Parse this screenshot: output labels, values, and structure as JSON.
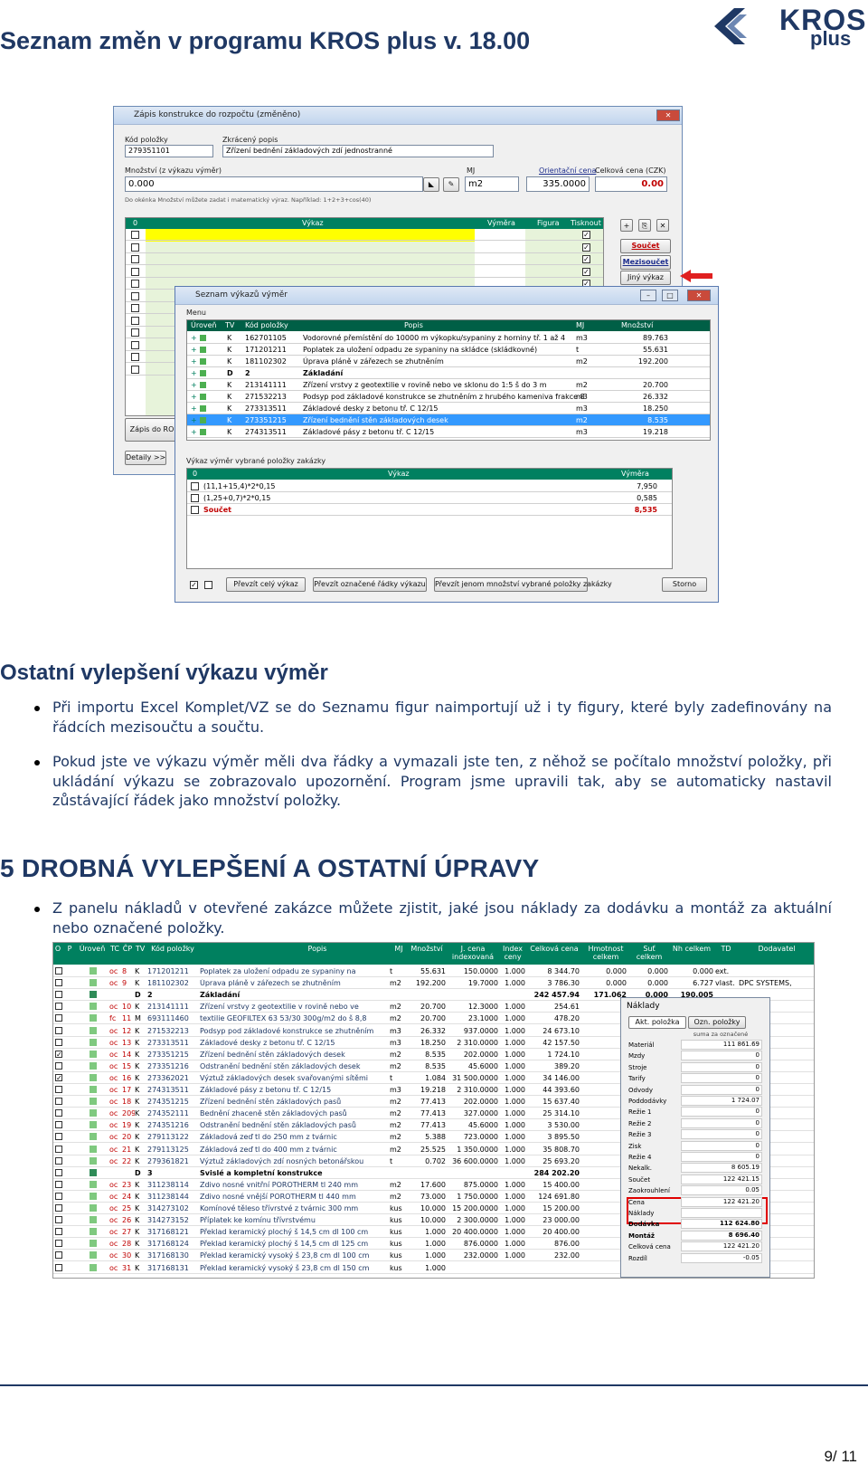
{
  "header": {
    "title": "Seznam změn v programu KROS plus v. 18.00",
    "logo_main": "KROS",
    "logo_sub": "plus"
  },
  "dialog1": {
    "title": "Zápis konstrukce do rozpočtu (změněno)",
    "kod_label": "Kód položky",
    "kod_value": "279351101",
    "popis_label": "Zkrácený popis",
    "popis_value": "Zřízení bednění základových zdí jednostranné",
    "mnozstvi_label": "Množství (z výkazu výměr)",
    "mnozstvi_value": "0.000",
    "hint": "Do okénka Množství můžete zadat i matematický výraz. Například: 1+2+3+cos(40)",
    "mj_label": "MJ",
    "mj_value": "m2",
    "cena_label": "Orientační cena",
    "cena_value": "335.0000",
    "celkova_label": "Celková cena (CZK)",
    "celkova_value": "0.00",
    "grid_headers": [
      "0",
      "Výkaz",
      "Výměra",
      "Figura",
      "Tisknout"
    ],
    "btn_soucet": "Součet",
    "btn_mezisoucet": "Mezisoučet",
    "btn_jiny": "Jiný výkaz",
    "btn_zapis": "Zápis do RO",
    "btn_detaily": "Detaily >>"
  },
  "dialog2": {
    "title": "Seznam výkazů výměr",
    "menu": "Menu",
    "headers": [
      "Úroveň",
      "TV",
      "Kód položky",
      "Popis",
      "MJ",
      "Množství"
    ],
    "rows": [
      {
        "tv": "K",
        "kod": "162701105",
        "popis": "Vodorovné přemístění do 10000 m výkopku/sypaniny z horniny tř. 1 až 4",
        "mj": "m3",
        "mn": "89.763"
      },
      {
        "tv": "K",
        "kod": "171201211",
        "popis": "Poplatek za uložení odpadu ze sypaniny na skládce (skládkovné)",
        "mj": "t",
        "mn": "55.631"
      },
      {
        "tv": "K",
        "kod": "181102302",
        "popis": "Úprava pláně v zářezech se zhutněním",
        "mj": "m2",
        "mn": "192.200"
      },
      {
        "tv": "D",
        "kod": "2",
        "popis": "Základání",
        "mj": "",
        "mn": ""
      },
      {
        "tv": "K",
        "kod": "213141111",
        "popis": "Zřízení vrstvy z geotextilie v rovině nebo ve sklonu do 1:5 š do 3 m",
        "mj": "m2",
        "mn": "20.700"
      },
      {
        "tv": "K",
        "kod": "271532213",
        "popis": "Podsyp pod základové konstrukce se zhutněním z hrubého kameniva frakce 8",
        "mj": "m3",
        "mn": "26.332"
      },
      {
        "tv": "K",
        "kod": "273313511",
        "popis": "Základové desky z betonu tř. C 12/15",
        "mj": "m3",
        "mn": "18.250"
      },
      {
        "tv": "K",
        "kod": "273351215",
        "popis": "Zřízení bednění stěn základových desek",
        "mj": "m2",
        "mn": "8.535"
      },
      {
        "tv": "K",
        "kod": "274313511",
        "popis": "Základové pásy z betonu tř. C 12/15",
        "mj": "m3",
        "mn": "19.218"
      }
    ],
    "sub_title": "Výkaz výměr vybrané položky zakázky",
    "sub_headers": [
      "0",
      "Výkaz",
      "Výměra"
    ],
    "sub_rows": [
      {
        "vykaz": "(11,1+15,4)*2*0,15",
        "vymera": "7,950"
      },
      {
        "vykaz": "(1,25+0,7)*2*0,15",
        "vymera": "0,585"
      },
      {
        "vykaz": "Součet",
        "vymera": "8,535"
      }
    ],
    "btn_cely": "Převzít celý výkaz",
    "btn_oznacene": "Převzít označené řádky výkazu",
    "btn_mnozstvi": "Převzít jenom množství vybrané položky zakázky",
    "btn_storno": "Storno"
  },
  "section1": {
    "title": "Ostatní vylepšení výkazu výměr",
    "bullets": [
      "Při importu Excel Komplet/VZ se do Seznamu figur naimportují už i ty figury, které byly zadefinovány na řádcích mezisoučtu a součtu.",
      "Pokud jste ve výkazu výměr měli dva řádky a vymazali jste ten, z něhož se počítalo množství položky, při ukládání výkazu se zobrazovalo upozornění. Program jsme upravili tak, aby se automaticky nastavil zůstávající řádek jako množství položky."
    ]
  },
  "section2": {
    "title": "5 DROBNÁ VYLEPŠENÍ A OSTATNÍ ÚPRAVY",
    "bullets": [
      "Z panelu nákladů v otevřené zakázce můžete zjistit, jaké jsou náklady za dodávku a montáž za aktuální nebo označené položky."
    ]
  },
  "table2": {
    "headers": [
      "O",
      "P",
      "Úroveň",
      "TC",
      "ČP",
      "TV",
      "Kód položky",
      "Popis",
      "MJ",
      "Množství",
      "J. cena indexovaná",
      "Index ceny",
      "Celková cena",
      "Hmotnost celkem",
      "Suť celkem",
      "Nh celkem",
      "TD",
      "Dodavatel"
    ],
    "rows": [
      {
        "tc": "oc",
        "cp": "8",
        "tv": "K",
        "kod": "171201211",
        "popis": "Poplatek za uložení odpadu ze sypaniny na",
        "mj": "t",
        "mn": "55.631",
        "jc": "150.0000",
        "idx": "1.000",
        "cc": "8 344.70",
        "hm": "0.000",
        "sut": "0.000",
        "nh": "0.000",
        "td": "ext.",
        "dod": "",
        "check": false
      },
      {
        "tc": "oc",
        "cp": "9",
        "tv": "K",
        "kod": "181102302",
        "popis": "Úprava pláně v zářezech se zhutněním",
        "mj": "m2",
        "mn": "192.200",
        "jc": "19.7000",
        "idx": "1.000",
        "cc": "3 786.30",
        "hm": "0.000",
        "sut": "0.000",
        "nh": "6.727",
        "td": "vlast.",
        "dod": "DPC SYSTEMS,",
        "check": false
      },
      {
        "tc": "",
        "cp": "",
        "tv": "D",
        "kod": "2",
        "popis": "Základání",
        "mj": "",
        "mn": "",
        "jc": "",
        "idx": "",
        "cc": "242 457.94",
        "hm": "171.062",
        "sut": "0.000",
        "nh": "190.005",
        "td": "",
        "dod": "",
        "check": false,
        "d": true
      },
      {
        "tc": "oc",
        "cp": "10",
        "tv": "K",
        "kod": "213141111",
        "popis": "Zřízení vrstvy z geotextilie v rovině nebo ve",
        "mj": "m2",
        "mn": "20.700",
        "jc": "12.3000",
        "idx": "1.000",
        "cc": "254.61",
        "hm": "",
        "sut": "",
        "nh": "",
        "td": "",
        "dod": "",
        "check": false
      },
      {
        "tc": "fc",
        "cp": "11",
        "tv": "M",
        "kod": "693111460",
        "popis": "textilie GEOFILTEX 63 53/30 300g/m2 do š 8,8",
        "mj": "m2",
        "mn": "20.700",
        "jc": "23.1000",
        "idx": "1.000",
        "cc": "478.20",
        "hm": "",
        "sut": "",
        "nh": "",
        "td": "",
        "dod": "",
        "check": false
      },
      {
        "tc": "oc",
        "cp": "12",
        "tv": "K",
        "kod": "271532213",
        "popis": "Podsyp pod základové konstrukce se zhutněním",
        "mj": "m3",
        "mn": "26.332",
        "jc": "937.0000",
        "idx": "1.000",
        "cc": "24 673.10",
        "hm": "",
        "sut": "",
        "nh": "",
        "td": "",
        "dod": "",
        "check": false
      },
      {
        "tc": "oc",
        "cp": "13",
        "tv": "K",
        "kod": "273313511",
        "popis": "Základové desky z betonu tř. C 12/15",
        "mj": "m3",
        "mn": "18.250",
        "jc": "2 310.0000",
        "idx": "1.000",
        "cc": "42 157.50",
        "hm": "",
        "sut": "",
        "nh": "",
        "td": "",
        "dod": "",
        "check": false
      },
      {
        "tc": "oc",
        "cp": "14",
        "tv": "K",
        "kod": "273351215",
        "popis": "Zřízení bednění stěn základových desek",
        "mj": "m2",
        "mn": "8.535",
        "jc": "202.0000",
        "idx": "1.000",
        "cc": "1 724.10",
        "hm": "",
        "sut": "",
        "nh": "",
        "td": "",
        "dod": "",
        "check": true
      },
      {
        "tc": "oc",
        "cp": "15",
        "tv": "K",
        "kod": "273351216",
        "popis": "Odstranění bednění stěn základových desek",
        "mj": "m2",
        "mn": "8.535",
        "jc": "45.6000",
        "idx": "1.000",
        "cc": "389.20",
        "hm": "",
        "sut": "",
        "nh": "",
        "td": "",
        "dod": "",
        "check": false
      },
      {
        "tc": "oc",
        "cp": "16",
        "tv": "K",
        "kod": "273362021",
        "popis": "Výztuž základových desek svařovanými sítěmi",
        "mj": "t",
        "mn": "1.084",
        "jc": "31 500.0000",
        "idx": "1.000",
        "cc": "34 146.00",
        "hm": "",
        "sut": "",
        "nh": "",
        "td": "",
        "dod": "",
        "check": true
      },
      {
        "tc": "oc",
        "cp": "17",
        "tv": "K",
        "kod": "274313511",
        "popis": "Základové pásy z betonu tř. C 12/15",
        "mj": "m3",
        "mn": "19.218",
        "jc": "2 310.0000",
        "idx": "1.000",
        "cc": "44 393.60",
        "hm": "",
        "sut": "",
        "nh": "",
        "td": "",
        "dod": "",
        "check": false
      },
      {
        "tc": "oc",
        "cp": "18",
        "tv": "K",
        "kod": "274351215",
        "popis": "Zřízení bednění stěn základových pasů",
        "mj": "m2",
        "mn": "77.413",
        "jc": "202.0000",
        "idx": "1.000",
        "cc": "15 637.40",
        "hm": "",
        "sut": "",
        "nh": "",
        "td": "",
        "dod": "",
        "check": false
      },
      {
        "tc": "oc",
        "cp": "209",
        "tv": "K",
        "kod": "274352111",
        "popis": "Bednění zhaceně stěn základových pasů",
        "mj": "m2",
        "mn": "77.413",
        "jc": "327.0000",
        "idx": "1.000",
        "cc": "25 314.10",
        "hm": "",
        "sut": "",
        "nh": "",
        "td": "",
        "dod": "",
        "check": false
      },
      {
        "tc": "oc",
        "cp": "19",
        "tv": "K",
        "kod": "274351216",
        "popis": "Odstranění bednění stěn základových pasů",
        "mj": "m2",
        "mn": "77.413",
        "jc": "45.6000",
        "idx": "1.000",
        "cc": "3 530.00",
        "hm": "",
        "sut": "",
        "nh": "",
        "td": "",
        "dod": "",
        "check": false
      },
      {
        "tc": "oc",
        "cp": "20",
        "tv": "K",
        "kod": "279113122",
        "popis": "Základová zeď tl do 250 mm z tvárnic",
        "mj": "m2",
        "mn": "5.388",
        "jc": "723.0000",
        "idx": "1.000",
        "cc": "3 895.50",
        "hm": "",
        "sut": "",
        "nh": "",
        "td": "",
        "dod": "",
        "check": false
      },
      {
        "tc": "oc",
        "cp": "21",
        "tv": "K",
        "kod": "279113125",
        "popis": "Základová zeď tl do 400 mm z tvárnic",
        "mj": "m2",
        "mn": "25.525",
        "jc": "1 350.0000",
        "idx": "1.000",
        "cc": "35 808.70",
        "hm": "",
        "sut": "",
        "nh": "",
        "td": "",
        "dod": "",
        "check": false
      },
      {
        "tc": "oc",
        "cp": "22",
        "tv": "K",
        "kod": "279361821",
        "popis": "Výztuž základových zdí nosných betonářskou",
        "mj": "t",
        "mn": "0.702",
        "jc": "36 600.0000",
        "idx": "1.000",
        "cc": "25 693.20",
        "hm": "",
        "sut": "",
        "nh": "",
        "td": "",
        "dod": "",
        "check": false
      },
      {
        "tc": "",
        "cp": "",
        "tv": "D",
        "kod": "3",
        "popis": "Svislé a kompletní konstrukce",
        "mj": "",
        "mn": "",
        "jc": "",
        "idx": "",
        "cc": "284 202.20",
        "hm": "",
        "sut": "",
        "nh": "",
        "td": "",
        "dod": "",
        "check": false,
        "d": true
      },
      {
        "tc": "oc",
        "cp": "23",
        "tv": "K",
        "kod": "311238114",
        "popis": "Zdivo nosné vnitřní POROTHERM tl 240 mm",
        "mj": "m2",
        "mn": "17.600",
        "jc": "875.0000",
        "idx": "1.000",
        "cc": "15 400.00",
        "hm": "",
        "sut": "",
        "nh": "",
        "td": "",
        "dod": "",
        "check": false
      },
      {
        "tc": "oc",
        "cp": "24",
        "tv": "K",
        "kod": "311238144",
        "popis": "Zdivo nosné vnější POROTHERM tl 440 mm",
        "mj": "m2",
        "mn": "73.000",
        "jc": "1 750.0000",
        "idx": "1.000",
        "cc": "124 691.80",
        "hm": "",
        "sut": "",
        "nh": "",
        "td": "",
        "dod": "",
        "check": false
      },
      {
        "tc": "oc",
        "cp": "25",
        "tv": "K",
        "kod": "314273102",
        "popis": "Komínové těleso třívrstvé z tvárnic 300 mm",
        "mj": "kus",
        "mn": "10.000",
        "jc": "15 200.0000",
        "idx": "1.000",
        "cc": "15 200.00",
        "hm": "",
        "sut": "",
        "nh": "",
        "td": "",
        "dod": "",
        "check": false
      },
      {
        "tc": "oc",
        "cp": "26",
        "tv": "K",
        "kod": "314273152",
        "popis": "Příplatek ke komínu třívrstvému",
        "mj": "kus",
        "mn": "10.000",
        "jc": "2 300.0000",
        "idx": "1.000",
        "cc": "23 000.00",
        "hm": "",
        "sut": "",
        "nh": "",
        "td": "",
        "dod": "",
        "check": false
      },
      {
        "tc": "oc",
        "cp": "27",
        "tv": "K",
        "kod": "317168121",
        "popis": "Překlad keramický plochý š 14,5 cm dl 100 cm",
        "mj": "kus",
        "mn": "1.000",
        "jc": "20 400.0000",
        "idx": "1.000",
        "cc": "20 400.00",
        "hm": "",
        "sut": "",
        "nh": "",
        "td": "",
        "dod": "",
        "check": false
      },
      {
        "tc": "oc",
        "cp": "28",
        "tv": "K",
        "kod": "317168124",
        "popis": "Překlad keramický plochý š 14,5 cm dl 125 cm",
        "mj": "kus",
        "mn": "1.000",
        "jc": "876.0000",
        "idx": "1.000",
        "cc": "876.00",
        "hm": "",
        "sut": "",
        "nh": "",
        "td": "",
        "dod": "",
        "check": false
      },
      {
        "tc": "oc",
        "cp": "30",
        "tv": "K",
        "kod": "317168130",
        "popis": "Překlad keramický vysoký š 23,8 cm dl 100 cm",
        "mj": "kus",
        "mn": "1.000",
        "jc": "232.0000",
        "idx": "1.000",
        "cc": "232.00",
        "hm": "",
        "sut": "",
        "nh": "",
        "td": "",
        "dod": "",
        "check": false
      },
      {
        "tc": "oc",
        "cp": "31",
        "tv": "K",
        "kod": "317168131",
        "popis": "Překlad keramický vysoký š 23,8 cm dl 150 cm",
        "mj": "kus",
        "mn": "1.000",
        "jc": "",
        "idx": "",
        "cc": "",
        "hm": "",
        "sut": "",
        "nh": "",
        "td": "",
        "dod": "",
        "check": false
      }
    ]
  },
  "naklady": {
    "title": "Náklady",
    "tab1": "Akt. položka",
    "tab2": "Ozn. položky",
    "col": "suma za označené",
    "rows": [
      {
        "label": "Materiál",
        "value": "111 861.69"
      },
      {
        "label": "Mzdy",
        "value": "0"
      },
      {
        "label": "Stroje",
        "value": "0"
      },
      {
        "label": "Tarify",
        "value": "0"
      },
      {
        "label": "Odvody",
        "value": "0"
      },
      {
        "label": "Poddodávky",
        "value": "1 724.07"
      },
      {
        "label": "Režie 1",
        "value": "0"
      },
      {
        "label": "Režie 2",
        "value": "0"
      },
      {
        "label": "Režie 3",
        "value": "0"
      },
      {
        "label": "Zisk",
        "value": "0"
      },
      {
        "label": "Režie 4",
        "value": "0"
      },
      {
        "label": "Nekalk.",
        "value": "8 605.19"
      },
      {
        "label": "Součet",
        "value": "122 421.15"
      },
      {
        "label": "Zaokrouhlení",
        "value": "0.05"
      },
      {
        "label": "Cena",
        "value": "122 421.20"
      },
      {
        "label": "Náklady",
        "value": ""
      },
      {
        "label": "Dodávka",
        "value": "112 624.80"
      },
      {
        "label": "Montáž",
        "value": "8 696.40"
      },
      {
        "label": "Celková cena",
        "value": "122 421.20"
      },
      {
        "label": "Rozdíl",
        "value": "-0.05"
      }
    ]
  },
  "footer": {
    "page": "9/ 11"
  },
  "colors": {
    "brand_navy": "#1f3864",
    "grid_green": "#008060",
    "highlight_red": "#c00000",
    "selection_blue": "#3399ff"
  }
}
